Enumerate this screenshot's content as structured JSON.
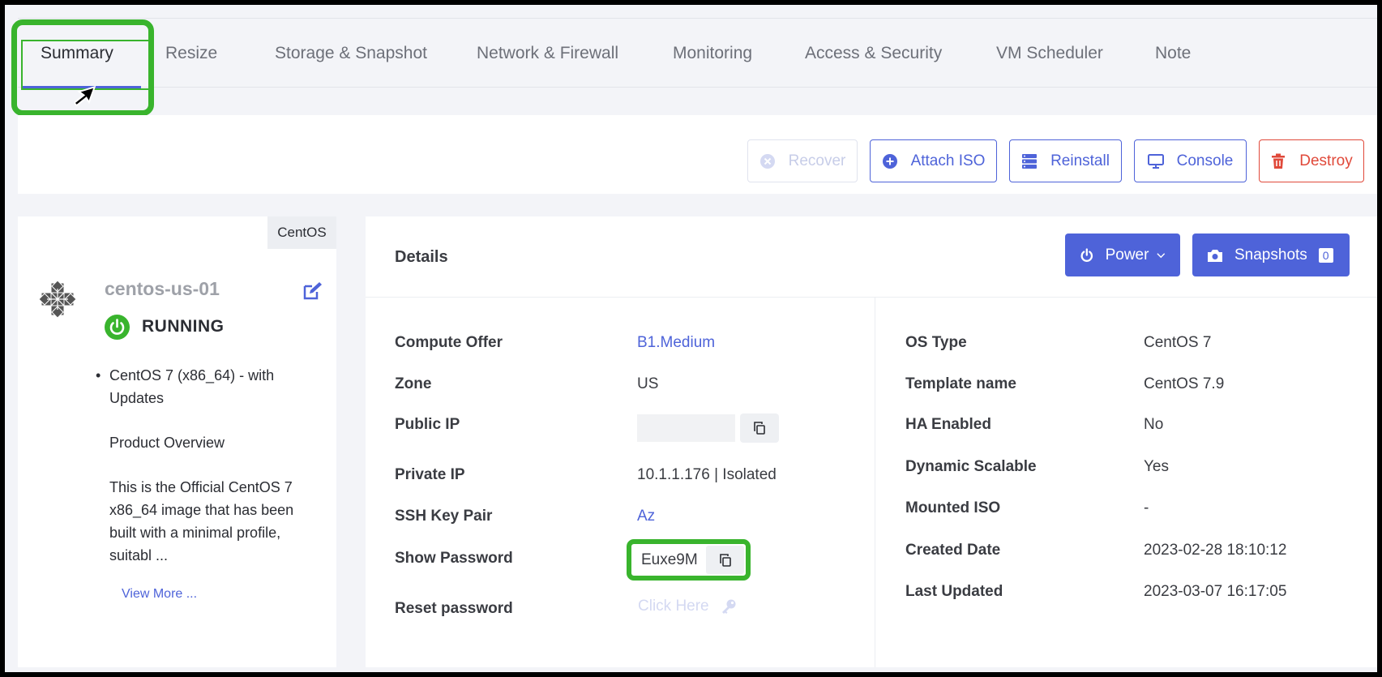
{
  "tabs": [
    {
      "label": "Summary",
      "active": true
    },
    {
      "label": "Resize"
    },
    {
      "label": "Storage & Snapshot"
    },
    {
      "label": "Network & Firewall"
    },
    {
      "label": "Monitoring"
    },
    {
      "label": "Access & Security"
    },
    {
      "label": "VM Scheduler"
    },
    {
      "label": "Note"
    }
  ],
  "actions": {
    "recover": {
      "label": "Recover",
      "icon": "x-circle-icon",
      "disabled": true
    },
    "attach_iso": {
      "label": "Attach ISO",
      "icon": "plus-circle-icon"
    },
    "reinstall": {
      "label": "Reinstall",
      "icon": "server-icon"
    },
    "console": {
      "label": "Console",
      "icon": "monitor-icon"
    },
    "destroy": {
      "label": "Destroy",
      "icon": "trash-icon"
    }
  },
  "vm": {
    "os_badge": "CentOS",
    "name": "centos-us-01",
    "status": "RUNNING",
    "description": {
      "bullet": "CentOS 7 (x86_64) - with Updates",
      "overview_title": "Product Overview",
      "overview_text": "This is the Official CentOS 7 x86_64 image that has been built with a minimal profile, suitabl ..."
    },
    "view_more": "View More ..."
  },
  "details": {
    "title": "Details",
    "power_label": "Power",
    "snapshots_label": "Snapshots",
    "snapshots_count": "0",
    "left": {
      "compute_offer": {
        "label": "Compute Offer",
        "value": "B1.Medium"
      },
      "zone": {
        "label": "Zone",
        "value": "US"
      },
      "public_ip": {
        "label": "Public IP",
        "value": ""
      },
      "private_ip": {
        "label": "Private IP",
        "value": "10.1.1.176 | Isolated"
      },
      "ssh_key_pair": {
        "label": "SSH Key Pair",
        "value": "Az"
      },
      "show_password": {
        "label": "Show Password",
        "value": "Euxe9M"
      },
      "reset_password": {
        "label": "Reset password",
        "value": "Click Here"
      }
    },
    "right": {
      "os_type": {
        "label": "OS Type",
        "value": "CentOS 7"
      },
      "template_name": {
        "label": "Template name",
        "value": "CentOS 7.9"
      },
      "ha_enabled": {
        "label": "HA Enabled",
        "value": "No"
      },
      "dynamic_scalable": {
        "label": "Dynamic Scalable",
        "value": "Yes"
      },
      "mounted_iso": {
        "label": "Mounted ISO",
        "value": "-"
      },
      "created_date": {
        "label": "Created Date",
        "value": "2023-02-28 18:10:12"
      },
      "last_updated": {
        "label": "Last Updated",
        "value": "2023-03-07 16:17:05"
      }
    }
  },
  "colors": {
    "accent": "#4e63d9",
    "danger": "#e0493a",
    "highlight": "#39b42d",
    "running": "#39b42d"
  }
}
